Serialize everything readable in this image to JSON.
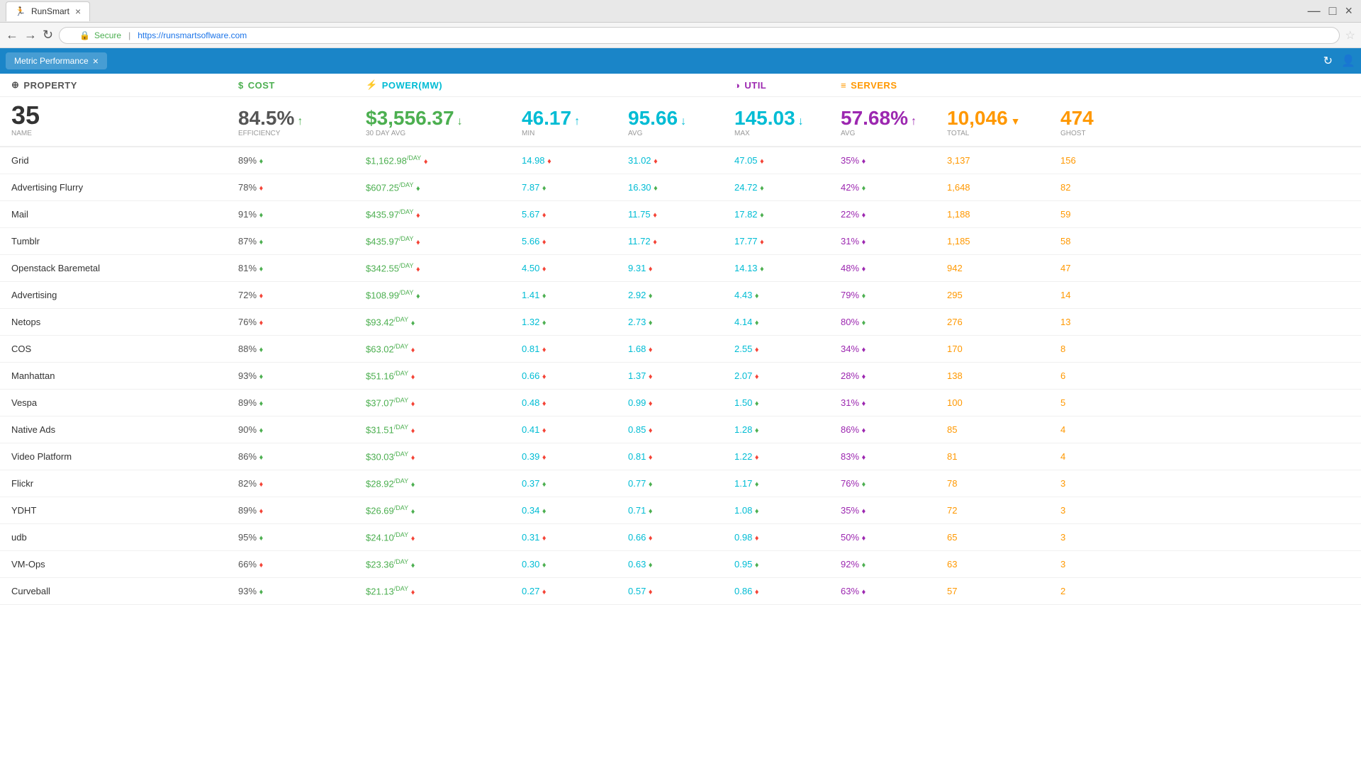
{
  "browser": {
    "tab_title": "RunSmart",
    "url": "https://runsmartsoflware.com",
    "url_display": "https://runsmartsoflware.com",
    "secure_label": "Secure",
    "app_tab_label": "Metric Performance"
  },
  "headers": {
    "property": "PROPERTY",
    "cost": "COST",
    "power": "POWER(MW)",
    "util": "UTIL",
    "servers": "SERVERS"
  },
  "summary": {
    "count": "35",
    "count_label": "NAME",
    "efficiency": "84.5%",
    "efficiency_label": "EFFICIENCY",
    "cost": "$3,556.37",
    "cost_dir": "↓",
    "cost_label": "30 DAY AVG",
    "power_min": "46.17",
    "power_min_dir": "↑",
    "power_min_label": "MIN",
    "power_avg": "95.66",
    "power_avg_dir": "↓",
    "power_avg_label": "AVG",
    "power_max": "145.03",
    "power_max_dir": "↓",
    "power_max_label": "MAX",
    "util": "57.68%",
    "util_dir": "↑",
    "util_label": "AVG",
    "total": "10,046",
    "total_label": "TOTAL",
    "ghost": "474",
    "ghost_label": "GHOST"
  },
  "rows": [
    {
      "name": "Grid",
      "efficiency": "89%",
      "eff_ind": "up",
      "cost": "$1,162.98",
      "cost_ind": "down",
      "power_min": "14.98",
      "pmin_ind": "down",
      "power_avg": "31.02",
      "pavg_ind": "down",
      "power_max": "47.05",
      "pmax_ind": "down",
      "util": "35%",
      "util_ind": "down",
      "total": "3,137",
      "ghost": "156"
    },
    {
      "name": "Advertising Flurry",
      "efficiency": "78%",
      "eff_ind": "down",
      "cost": "$607.25",
      "cost_ind": "up",
      "power_min": "7.87",
      "pmin_ind": "up",
      "power_avg": "16.30",
      "pavg_ind": "up",
      "power_max": "24.72",
      "pmax_ind": "up",
      "util": "42%",
      "util_ind": "up",
      "total": "1,648",
      "ghost": "82"
    },
    {
      "name": "Mail",
      "efficiency": "91%",
      "eff_ind": "up",
      "cost": "$435.97",
      "cost_ind": "down",
      "power_min": "5.67",
      "pmin_ind": "down",
      "power_avg": "11.75",
      "pavg_ind": "down",
      "power_max": "17.82",
      "pmax_ind": "up",
      "util": "22%",
      "util_ind": "down",
      "total": "1,188",
      "ghost": "59"
    },
    {
      "name": "Tumblr",
      "efficiency": "87%",
      "eff_ind": "up",
      "cost": "$435.97",
      "cost_ind": "down",
      "power_min": "5.66",
      "pmin_ind": "down",
      "power_avg": "11.72",
      "pavg_ind": "down",
      "power_max": "17.77",
      "pmax_ind": "down",
      "util": "31%",
      "util_ind": "down",
      "total": "1,185",
      "ghost": "58"
    },
    {
      "name": "Openstack Baremetal",
      "efficiency": "81%",
      "eff_ind": "up",
      "cost": "$342.55",
      "cost_ind": "down",
      "power_min": "4.50",
      "pmin_ind": "down",
      "power_avg": "9.31",
      "pavg_ind": "down",
      "power_max": "14.13",
      "pmax_ind": "up",
      "util": "48%",
      "util_ind": "down",
      "total": "942",
      "ghost": "47"
    },
    {
      "name": "Advertising",
      "efficiency": "72%",
      "eff_ind": "down",
      "cost": "$108.99",
      "cost_ind": "up",
      "power_min": "1.41",
      "pmin_ind": "up",
      "power_avg": "2.92",
      "pavg_ind": "up",
      "power_max": "4.43",
      "pmax_ind": "up",
      "util": "79%",
      "util_ind": "up",
      "total": "295",
      "ghost": "14"
    },
    {
      "name": "Netops",
      "efficiency": "76%",
      "eff_ind": "down",
      "cost": "$93.42",
      "cost_ind": "up",
      "power_min": "1.32",
      "pmin_ind": "up",
      "power_avg": "2.73",
      "pavg_ind": "up",
      "power_max": "4.14",
      "pmax_ind": "up",
      "util": "80%",
      "util_ind": "up",
      "total": "276",
      "ghost": "13"
    },
    {
      "name": "COS",
      "efficiency": "88%",
      "eff_ind": "up",
      "cost": "$63.02",
      "cost_ind": "down",
      "power_min": "0.81",
      "pmin_ind": "down",
      "power_avg": "1.68",
      "pavg_ind": "down",
      "power_max": "2.55",
      "pmax_ind": "down",
      "util": "34%",
      "util_ind": "down",
      "total": "170",
      "ghost": "8"
    },
    {
      "name": "Manhattan",
      "efficiency": "93%",
      "eff_ind": "up",
      "cost": "$51.16",
      "cost_ind": "down",
      "power_min": "0.66",
      "pmin_ind": "down",
      "power_avg": "1.37",
      "pavg_ind": "down",
      "power_max": "2.07",
      "pmax_ind": "down",
      "util": "28%",
      "util_ind": "down",
      "total": "138",
      "ghost": "6"
    },
    {
      "name": "Vespa",
      "efficiency": "89%",
      "eff_ind": "up",
      "cost": "$37.07",
      "cost_ind": "down",
      "power_min": "0.48",
      "pmin_ind": "down",
      "power_avg": "0.99",
      "pavg_ind": "down",
      "power_max": "1.50",
      "pmax_ind": "up",
      "util": "31%",
      "util_ind": "down",
      "total": "100",
      "ghost": "5"
    },
    {
      "name": "Native Ads",
      "efficiency": "90%",
      "eff_ind": "up",
      "cost": "$31.51",
      "cost_ind": "down",
      "power_min": "0.41",
      "pmin_ind": "down",
      "power_avg": "0.85",
      "pavg_ind": "down",
      "power_max": "1.28",
      "pmax_ind": "up",
      "util": "86%",
      "util_ind": "down",
      "total": "85",
      "ghost": "4"
    },
    {
      "name": "Video Platform",
      "efficiency": "86%",
      "eff_ind": "up",
      "cost": "$30.03",
      "cost_ind": "down",
      "power_min": "0.39",
      "pmin_ind": "down",
      "power_avg": "0.81",
      "pavg_ind": "down",
      "power_max": "1.22",
      "pmax_ind": "down",
      "util": "83%",
      "util_ind": "down",
      "total": "81",
      "ghost": "4"
    },
    {
      "name": "Flickr",
      "efficiency": "82%",
      "eff_ind": "down",
      "cost": "$28.92",
      "cost_ind": "up",
      "power_min": "0.37",
      "pmin_ind": "up",
      "power_avg": "0.77",
      "pavg_ind": "up",
      "power_max": "1.17",
      "pmax_ind": "up",
      "util": "76%",
      "util_ind": "up",
      "total": "78",
      "ghost": "3"
    },
    {
      "name": "YDHT",
      "efficiency": "89%",
      "eff_ind": "down",
      "cost": "$26.69",
      "cost_ind": "up",
      "power_min": "0.34",
      "pmin_ind": "up",
      "power_avg": "0.71",
      "pavg_ind": "up",
      "power_max": "1.08",
      "pmax_ind": "up",
      "util": "35%",
      "util_ind": "down",
      "total": "72",
      "ghost": "3"
    },
    {
      "name": "udb",
      "efficiency": "95%",
      "eff_ind": "up",
      "cost": "$24.10",
      "cost_ind": "down",
      "power_min": "0.31",
      "pmin_ind": "down",
      "power_avg": "0.66",
      "pavg_ind": "down",
      "power_max": "0.98",
      "pmax_ind": "down",
      "util": "50%",
      "util_ind": "down",
      "total": "65",
      "ghost": "3"
    },
    {
      "name": "VM-Ops",
      "efficiency": "66%",
      "eff_ind": "down",
      "cost": "$23.36",
      "cost_ind": "up",
      "power_min": "0.30",
      "pmin_ind": "up",
      "power_avg": "0.63",
      "pavg_ind": "up",
      "power_max": "0.95",
      "pmax_ind": "up",
      "util": "92%",
      "util_ind": "up",
      "total": "63",
      "ghost": "3"
    },
    {
      "name": "Curveball",
      "efficiency": "93%",
      "eff_ind": "up",
      "cost": "$21.13",
      "cost_ind": "down",
      "power_min": "0.27",
      "pmin_ind": "down",
      "power_avg": "0.57",
      "pavg_ind": "down",
      "power_max": "0.86",
      "pmax_ind": "down",
      "util": "63%",
      "util_ind": "down",
      "total": "57",
      "ghost": "2"
    }
  ]
}
